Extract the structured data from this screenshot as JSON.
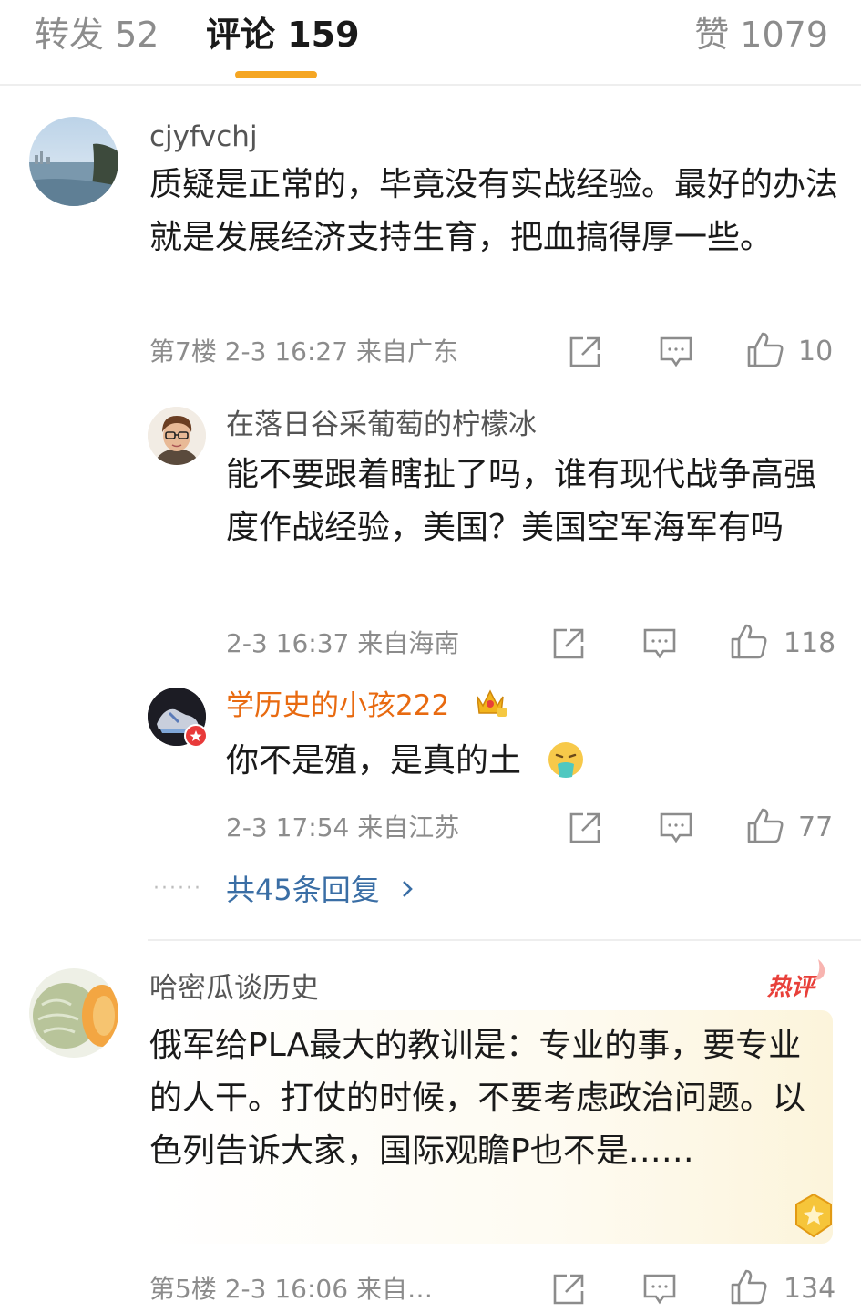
{
  "tabs": {
    "repost": "转发 52",
    "comments": "评论 159",
    "likes": "赞 1079",
    "active_color": "#f5a623"
  },
  "comments": [
    {
      "username": "cjyfvchj",
      "text": "质疑是正常的，毕竟没有实战经验。最好的办法就是发展经济支持生育，把血搞得厚一些。",
      "meta": "第7楼 2-3 16:27 来自广东",
      "likes": "10",
      "avatar_icon": "landscape-avatar-icon"
    },
    {
      "username": "在落日谷采葡萄的柠檬冰",
      "text": "能不要跟着瞎扯了吗，谁有现代战争高强度作战经验，美国？美国空军海军有吗",
      "meta": "2-3 16:37 来自海南",
      "likes": "118",
      "avatar_icon": "cartoon-man-avatar-icon"
    },
    {
      "username": "学历史的小孩222",
      "text": "你不是殖，是真的土",
      "meta": "2-3 17:54 来自江苏",
      "likes": "77",
      "avatar_icon": "sneaker-avatar-icon",
      "badge_icon": "crown-badge-icon",
      "emoji_icon": "vomit-face-emoji-icon"
    },
    {
      "username": "哈密瓜谈历史",
      "text": "俄军给PLA最大的教训是：专业的事，要专业的人干。打仗的时候，不要考虑政治问题。以色列告诉大家，国际观瞻P也不是……",
      "meta": "第5楼 2-3 16:06 来自…",
      "likes": "134",
      "avatar_icon": "melon-avatar-icon",
      "hot_label": "热评"
    }
  ],
  "replies_link": "共45条回复",
  "colors": {
    "vip_name": "#e86a10",
    "link": "#3a6ea5",
    "hot": "#e8403a"
  }
}
